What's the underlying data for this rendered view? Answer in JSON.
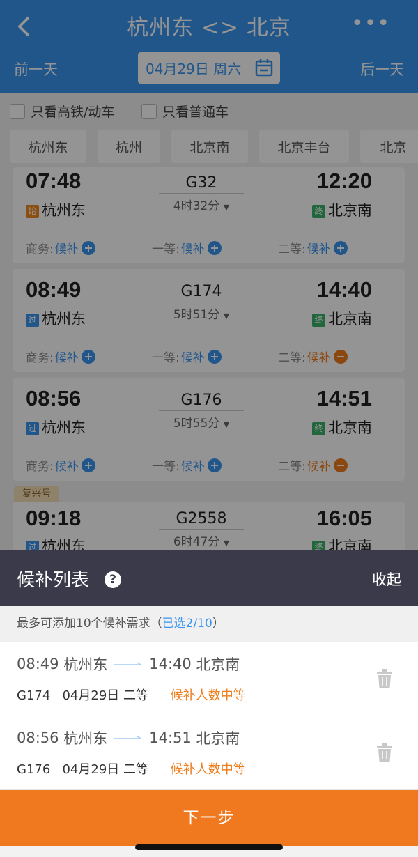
{
  "header": {
    "title": "杭州东 <> 北京",
    "prev_day": "前一天",
    "next_day": "后一天",
    "date": "04月29日 周六",
    "colors": {
      "primary": "#3a95f0"
    }
  },
  "filters": {
    "high_speed_only": "只看高铁/动车",
    "regular_only": "只看普通车"
  },
  "station_tabs": [
    "杭州东",
    "杭州",
    "北京南",
    "北京丰台",
    "北京"
  ],
  "trains": [
    {
      "depart": "07:48",
      "origin_tag": "始",
      "from": "杭州东",
      "train_no": "G32",
      "duration": "4时32分",
      "arrive": "12:20",
      "dest_tag": "终",
      "to": "北京南",
      "seats": [
        {
          "label": "商务:",
          "status": "候补",
          "icon": "plus"
        },
        {
          "label": "一等:",
          "status": "候补",
          "icon": "plus"
        },
        {
          "label": "二等:",
          "status": "候补",
          "icon": "plus"
        }
      ]
    },
    {
      "depart": "08:49",
      "origin_tag": "过",
      "from": "杭州东",
      "train_no": "G174",
      "duration": "5时51分",
      "arrive": "14:40",
      "dest_tag": "终",
      "to": "北京南",
      "seats": [
        {
          "label": "商务:",
          "status": "候补",
          "icon": "plus"
        },
        {
          "label": "一等:",
          "status": "候补",
          "icon": "plus"
        },
        {
          "label": "二等:",
          "status": "候补",
          "icon": "minus"
        }
      ]
    },
    {
      "depart": "08:56",
      "origin_tag": "过",
      "from": "杭州东",
      "train_no": "G176",
      "duration": "5时55分",
      "arrive": "14:51",
      "dest_tag": "终",
      "to": "北京南",
      "seats": [
        {
          "label": "商务:",
          "status": "候补",
          "icon": "plus"
        },
        {
          "label": "一等:",
          "status": "候补",
          "icon": "plus"
        },
        {
          "label": "二等:",
          "status": "候补",
          "icon": "minus"
        }
      ]
    },
    {
      "badge": "复兴号",
      "depart": "09:18",
      "origin_tag": "过",
      "from": "杭州东",
      "train_no": "G2558",
      "duration": "6时47分",
      "arrive": "16:05",
      "dest_tag": "终",
      "to": "北京南"
    }
  ],
  "waitlist": {
    "title": "候补列表",
    "collapse": "收起",
    "note_prefix": "最多可添加10个候补需求（",
    "note_highlight": "已选2/10",
    "note_suffix": "）",
    "items": [
      {
        "depart": "08:49",
        "from": "杭州东",
        "arrive": "14:40",
        "to": "北京南",
        "train_no": "G174",
        "date": "04月29日",
        "seat": "二等",
        "status": "候补人数中等"
      },
      {
        "depart": "08:56",
        "from": "杭州东",
        "arrive": "14:51",
        "to": "北京南",
        "train_no": "G176",
        "date": "04月29日",
        "seat": "二等",
        "status": "候补人数中等"
      }
    ]
  },
  "next_button": "下一步"
}
